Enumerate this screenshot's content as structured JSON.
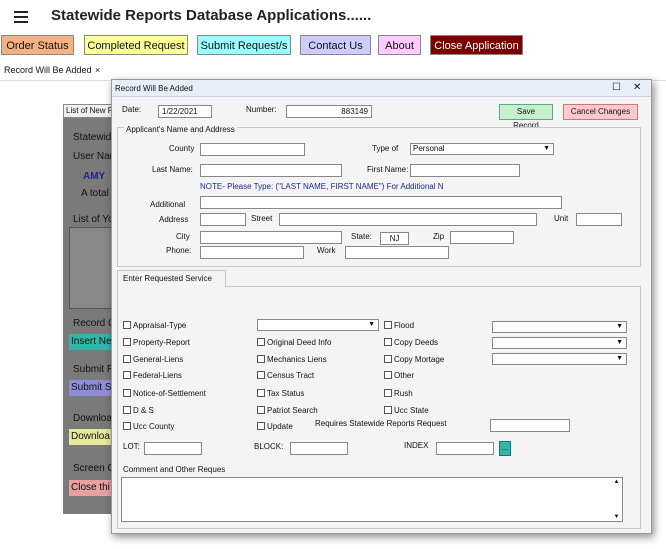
{
  "app": {
    "title": "Statewide Reports Database Applications......",
    "nav": [
      {
        "label": "Order Status",
        "bg": "#f4b183"
      },
      {
        "label": "Completed Request",
        "bg": "#ffff99"
      },
      {
        "label": "Submit Request/s",
        "bg": "#99ffff"
      },
      {
        "label": "Contact Us",
        "bg": "#ccccff"
      },
      {
        "label": "About",
        "bg": "#ffccff"
      },
      {
        "label": "Close Application",
        "bg": "#7a0000"
      }
    ],
    "tab_label": "Record Will Be Added",
    "tab_close": "×"
  },
  "background_window": {
    "title": "List of New R",
    "texts": [
      "Statewid",
      "User Nam",
      "AMY",
      "A total",
      "List of Yo",
      "Record C",
      "Submit R",
      "Downloa",
      "Screen C"
    ],
    "buttons": [
      {
        "label": "Insert Ne",
        "bg": "#2fb7a9"
      },
      {
        "label": "Submit S",
        "bg": "#8e8ed8"
      },
      {
        "label": "Downloa",
        "bg": "#e8e89a"
      },
      {
        "label": "Close thi",
        "bg": "#e8a0a0"
      }
    ]
  },
  "dialog": {
    "title": "Record Will Be Added",
    "date_label": "Date:",
    "date_value": "1/22/2021",
    "number_label": "Number:",
    "number_value": "883149",
    "save_label": "Save Record",
    "cancel_label": "Cancel Changes",
    "applicant_group": "Applicant's Name and Address",
    "county_label": "County",
    "county_value": "",
    "type_label": "Type of",
    "type_value": "Personal",
    "last_name_label": "Last Name:",
    "first_name_label": "First Name:",
    "note": "NOTE- Please Type: (\"LAST NAME, FIRST NAME\") For Additional N",
    "additional_label": "Additional",
    "address_label": "Address",
    "street_label": "Street",
    "unit_label": "Unit",
    "city_label": "City",
    "state_label": "State:",
    "state_value": "NJ",
    "zip_label": "Zip",
    "phone_label": "Phone:",
    "work_label": "Work",
    "service_tab": "Enter Requested Service",
    "checkboxes": [
      "Appraisal-Type",
      "Property-Report",
      "General-Liens",
      "Federal-Liens",
      "Notice-of-Settlement",
      "D & S",
      "Ucc County",
      "Original Deed Info",
      "Mechanics Liens",
      "Census Tract",
      "Tax Status",
      "Patriot Search",
      "Update",
      "Flood",
      "Copy Deeds",
      "Copy Mortage",
      "Other",
      "Rush",
      "Ucc State"
    ],
    "requires_label": "Requires Statewide Reports Request",
    "lot_label": "LOT:",
    "block_label": "BLOCK:",
    "index_label": "INDEX",
    "index_btn": "...",
    "comment_label": "Comment and Other Reques"
  },
  "colors": {
    "save": "#c6efce",
    "cancel": "#ffc7ce",
    "index_btn": "#2fb7a9"
  }
}
